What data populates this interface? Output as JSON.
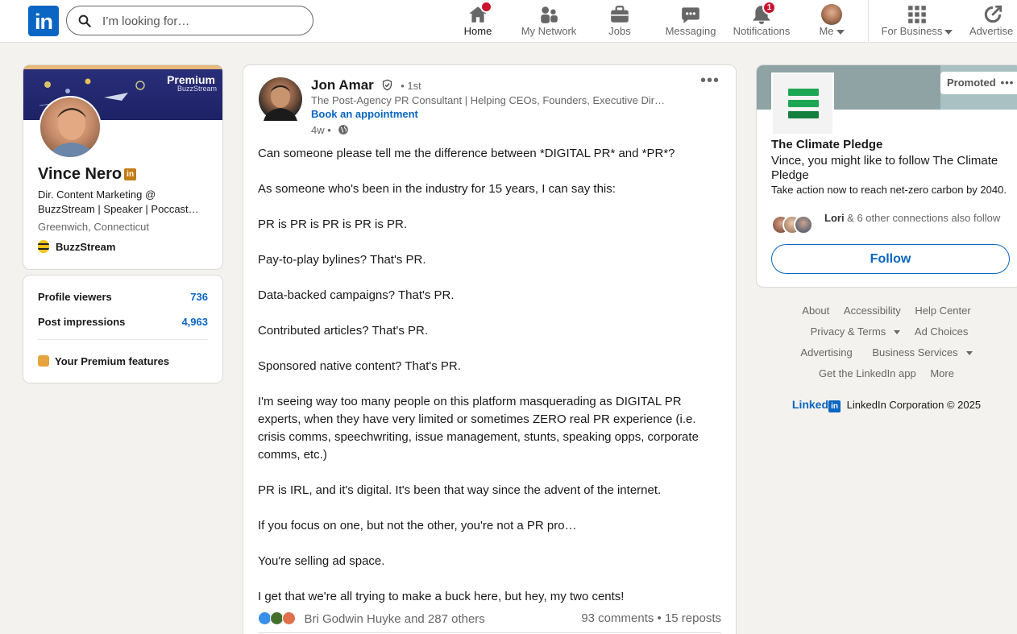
{
  "nav": {
    "logo": "in",
    "search_placeholder": "I’m looking for…",
    "items": [
      {
        "label": "Home",
        "icon": "home-icon"
      },
      {
        "label": "My Network",
        "icon": "network-icon"
      },
      {
        "label": "Jobs",
        "icon": "briefcase-icon"
      },
      {
        "label": "Messaging",
        "icon": "messaging-icon"
      },
      {
        "label": "Notifications",
        "icon": "bell-icon",
        "badge": "1"
      },
      {
        "label": "Me",
        "icon": "avatar"
      },
      {
        "label": "For Business",
        "icon": "grid-icon"
      },
      {
        "label": "Advertise",
        "icon": "advertise-icon"
      }
    ]
  },
  "profile": {
    "banner_title": "Premium",
    "banner_brand": "BuzzStream",
    "name": "Vince Nero",
    "headline": "Dir. Content Marketing @ BuzzStream | Speaker | Poccast…",
    "location": "Greenwich, Connecticut",
    "company": "BuzzStream"
  },
  "stats": {
    "profile_viewers_label": "Profile viewers",
    "profile_viewers_value": "736",
    "post_impressions_label": "Post impressions",
    "post_impressions_value": "4,963",
    "premium_features": "Your Premium features"
  },
  "post": {
    "author": "Jon Amar",
    "degree": "• 1st",
    "subtitle": "The Post-Agency PR Consultant | Helping CEOs, Founders, Executive Dir…",
    "cta": "Book an appointment",
    "time": "4w •",
    "paragraphs": [
      "Can someone please tell me the difference between *DIGITAL PR* and *PR*?",
      "As someone who's been in the industry for 15 years, I can say this:",
      "PR is PR is PR is PR is PR.",
      "Pay-to-play bylines? That's PR.",
      "Data-backed campaigns? That's PR.",
      "Contributed articles? That's PR.",
      "Sponsored native content? That's PR.",
      "I'm seeing way too many people on this platform masquerading as DIGITAL PR experts, when they have very limited or sometimes ZERO real PR experience (i.e. crisis comms, speechwriting, issue management, stunts, speaking opps, corporate comms, etc.)",
      "PR is IRL, and it's digital. It's been that way since the advent of the internet.",
      "If you focus on one, but not the other, you're not a PR pro…",
      "You're selling ad space.",
      "I get that we're all trying to make a buck here, but hey, my two cents!"
    ],
    "reactions": "Bri Godwin Huyke and 287 others",
    "counts": "93 comments • 15 reposts"
  },
  "ad": {
    "promoted": "Promoted",
    "title": "The Climate Pledge",
    "message": "Vince, you might like to follow The Climate Pledge",
    "sub": "Take action now to reach net-zero carbon by 2040.",
    "connection_name": "Lori",
    "connection_rest": " & 6 other connections also follow",
    "follow": "Follow",
    "brand_color": "#1da653"
  },
  "footer": {
    "about": "About",
    "accessibility": "Accessibility",
    "help": "Help Center",
    "privacy": "Privacy & Terms",
    "adchoices": "Ad Choices",
    "advertising": "Advertising",
    "business": "Business Services",
    "app": "Get the LinkedIn app",
    "more": "More",
    "brand": "Linked",
    "copyright": "LinkedIn Corporation © 2025"
  },
  "colors": {
    "accent": "#0a66c2",
    "badge": "#cb112d",
    "background": "#f4f2ee"
  }
}
